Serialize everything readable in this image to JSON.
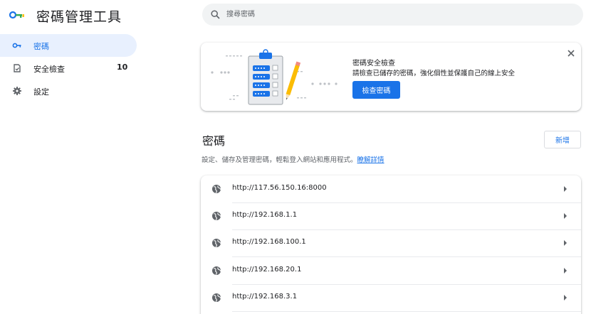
{
  "app": {
    "title": "密碼管理工具"
  },
  "sidebar": {
    "items": [
      {
        "label": "密碼",
        "icon": "key-icon",
        "active": true
      },
      {
        "label": "安全檢查",
        "icon": "shield-check-icon",
        "badge": "10"
      },
      {
        "label": "設定",
        "icon": "gear-icon"
      }
    ]
  },
  "search": {
    "placeholder": "搜尋密碼"
  },
  "banner": {
    "title": "密碼安全檢查",
    "description": "請檢查已儲存的密碼，強化個性並保護自己的線上安全",
    "button_label": "檢查密碼"
  },
  "passwords": {
    "title": "密碼",
    "add_label": "新增",
    "description": "設定、儲存及管理密碼，輕鬆登入網站和應用程式。",
    "learn_more": "瞭解詳情",
    "items": [
      {
        "url": "http://117.56.150.16:8000"
      },
      {
        "url": "http://192.168.1.1"
      },
      {
        "url": "http://192.168.100.1"
      },
      {
        "url": "http://192.168.20.1"
      },
      {
        "url": "http://192.168.3.1"
      }
    ]
  },
  "colors": {
    "accent": "#1a73e8",
    "active_bg": "#e8f0fe",
    "logo_green": "#34a853"
  }
}
